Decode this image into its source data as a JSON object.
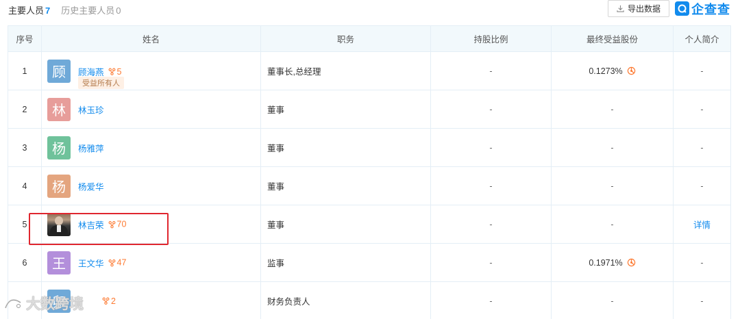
{
  "tabs": [
    {
      "label": "主要人员",
      "count": "7",
      "active": true
    },
    {
      "label": "历史主要人员",
      "count": "0",
      "active": false
    }
  ],
  "toolbar": {
    "export_label": "导出数据"
  },
  "brand": {
    "name": "企查查",
    "accent": "#128bed"
  },
  "table": {
    "headers": [
      "序号",
      "姓名",
      "职务",
      "持股比例",
      "最终受益股份",
      "个人简介"
    ],
    "rows": [
      {
        "index": "1",
        "avatar": "顾",
        "avatar_color": "#6fa9d8",
        "name": "顾海燕",
        "relations": "5",
        "tag": "受益所有人",
        "position": "董事长,总经理",
        "holding": "-",
        "final_share": "0.1273%",
        "bio": "-"
      },
      {
        "index": "2",
        "avatar": "林",
        "avatar_color": "#e79d9a",
        "name": "林玉珍",
        "relations": "",
        "tag": "",
        "position": "董事",
        "holding": "-",
        "final_share": "-",
        "bio": "-"
      },
      {
        "index": "3",
        "avatar": "杨",
        "avatar_color": "#6fc29b",
        "name": "杨雅萍",
        "relations": "",
        "tag": "",
        "position": "董事",
        "holding": "-",
        "final_share": "-",
        "bio": "-"
      },
      {
        "index": "4",
        "avatar": "杨",
        "avatar_color": "#e4a57f",
        "name": "杨爱华",
        "relations": "",
        "tag": "",
        "position": "董事",
        "holding": "-",
        "final_share": "-",
        "bio": "-"
      },
      {
        "index": "5",
        "avatar": "",
        "avatar_color": "",
        "name": "林吉荣",
        "relations": "70",
        "tag": "",
        "position": "董事",
        "holding": "-",
        "final_share": "-",
        "bio": "详情"
      },
      {
        "index": "6",
        "avatar": "王",
        "avatar_color": "#b38fdb",
        "name": "王文华",
        "relations": "47",
        "tag": "",
        "position": "监事",
        "holding": "-",
        "final_share": "0.1971%",
        "bio": "-"
      },
      {
        "index": "",
        "avatar": "卯",
        "avatar_color": "#6fa9d8",
        "name": "",
        "relations": "2",
        "tag": "",
        "position": "财务负责人",
        "holding": "-",
        "final_share": "-",
        "bio": "-"
      }
    ]
  },
  "watermark": {
    "text": "大数跨境"
  },
  "colors": {
    "link": "#128bed",
    "relation": "#fd7a32",
    "highlight": "#e0262e",
    "header_bg": "#f2f9fc"
  },
  "icons": {
    "export": "download-icon",
    "relation": "relation-network-icon",
    "share": "equity-chart-icon"
  }
}
